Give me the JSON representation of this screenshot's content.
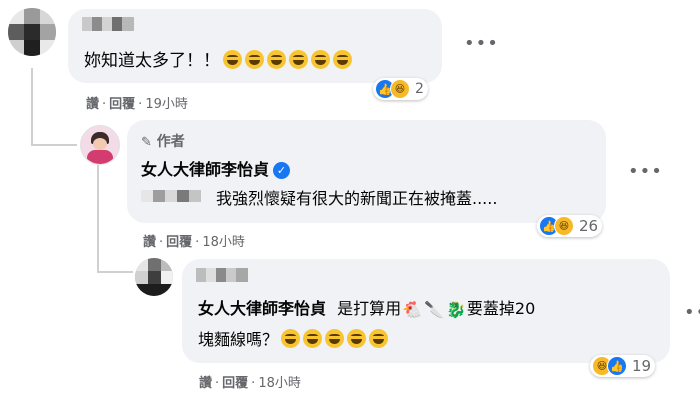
{
  "comments": [
    {
      "text": "妳知道太多了！！",
      "emoji_count": 6,
      "reaction_count": "2",
      "actions": {
        "like": "讚",
        "reply": "回覆",
        "time": "19小時"
      }
    },
    {
      "author_badge": "作者",
      "author": "女人大律師李怡貞",
      "text": "我強烈懷疑有很大的新聞正在被掩蓋.....",
      "reaction_count": "26",
      "actions": {
        "like": "讚",
        "reply": "回覆",
        "time": "18小時"
      }
    },
    {
      "mention": "女人大律師李怡貞",
      "text_before_icons": "是打算用",
      "text_after_icons": "要蓋掉20",
      "text_line2": "塊麵線嗎？",
      "emoji_count": 5,
      "reaction_count": "19",
      "actions": {
        "like": "讚",
        "reply": "回覆",
        "time": "18小時"
      }
    }
  ],
  "icons": {
    "more": "more-options-icon",
    "like": "like-reaction-icon",
    "haha": "haha-reaction-icon",
    "pen": "pen-icon",
    "verified": "verified-badge-icon",
    "chicken": "chicken-icon",
    "knife": "knife-icon",
    "dragon": "dragon-icon"
  },
  "colors": {
    "bubble": "#f0f2f5",
    "like_blue": "#1877f2",
    "haha_yellow": "#f7b928",
    "meta_gray": "#65676b"
  }
}
